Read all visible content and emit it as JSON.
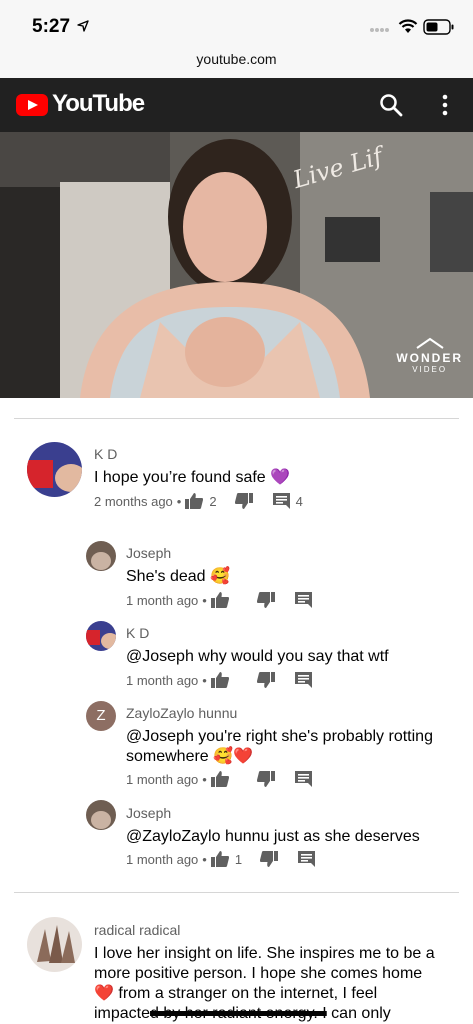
{
  "status": {
    "time": "5:27"
  },
  "browser": {
    "url": "youtube.com"
  },
  "header": {
    "logo_text": "YouTube"
  },
  "video": {
    "watermark_title": "WONDER",
    "watermark_sub": "VIDEO",
    "overlay_text": "Live Lif"
  },
  "comments": [
    {
      "author": "K D",
      "text": "I hope you’re found safe 💜",
      "time": "2 months ago",
      "likes": "2",
      "replies": "4",
      "replies_list": [
        {
          "author": "Joseph",
          "text": "She's dead 🥰",
          "time": "1 month ago",
          "likes": ""
        },
        {
          "author": "K D",
          "text": "@Joseph why would you say that wtf",
          "time": "1 month ago",
          "likes": ""
        },
        {
          "author": "ZayloZaylo hunnu",
          "avatar_letter": "Z",
          "text_line1": "@Joseph you're right she's probably rotting",
          "text_line2": "somewhere 🥰❤️",
          "time": "1 month ago",
          "likes": ""
        },
        {
          "author": "Joseph",
          "text": "@ZayloZaylo hunnu just as she deserves",
          "time": "1 month ago",
          "likes": "1"
        }
      ]
    },
    {
      "author": "radical radical",
      "text_line1": "I love her insight on life. She inspires me to be a",
      "text_line2": "more positive person. I hope she comes home",
      "text_line3": "❤️ from a stranger on the internet, I feel",
      "text_line4_a": "impacte",
      "text_line4_b": "d by her radiant energy. I",
      "text_line4_c": " can only"
    }
  ],
  "colors": {
    "header_bg": "#212121",
    "brand_red": "#ff0000",
    "divider": "#d6d6d6"
  }
}
